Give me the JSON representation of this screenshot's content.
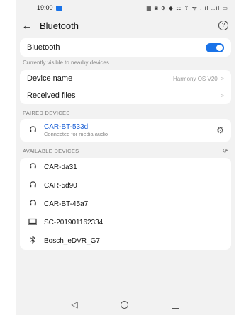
{
  "status_bar": {
    "time": "19:00",
    "icons": "▦ ◙ ⊕ ◆ ☷ ⇪ ᯤ ..ıl ..ıl ▭"
  },
  "header": {
    "back_icon": "←",
    "title": "Bluetooth",
    "help_icon": "?"
  },
  "bluetooth": {
    "label": "Bluetooth",
    "enabled": true,
    "visibility_hint": "Currently visible to nearby devices"
  },
  "settings": [
    {
      "label": "Device name",
      "value": "Harmony OS V20",
      "chevron": ">"
    },
    {
      "label": "Received files",
      "value": "",
      "chevron": ">"
    }
  ],
  "paired_section": {
    "title": "PAIRED DEVICES"
  },
  "paired_devices": [
    {
      "name": "CAR-BT-533d",
      "status": "Connected for media audio",
      "icon": "headset-icon"
    }
  ],
  "available_section": {
    "title": "AVAILABLE DEVICES"
  },
  "available_devices": [
    {
      "name": "CAR-da31",
      "icon": "headset-icon"
    },
    {
      "name": "CAR-5d90",
      "icon": "headset-icon"
    },
    {
      "name": "CAR-BT-45a7",
      "icon": "headset-icon"
    },
    {
      "name": "SC-201901162334",
      "icon": "computer-icon"
    },
    {
      "name": "Bosch_eDVR_G7",
      "icon": "bluetooth-icon"
    }
  ],
  "colors": {
    "accent": "#1a73e8",
    "paired_name": "#1a5fd6"
  }
}
